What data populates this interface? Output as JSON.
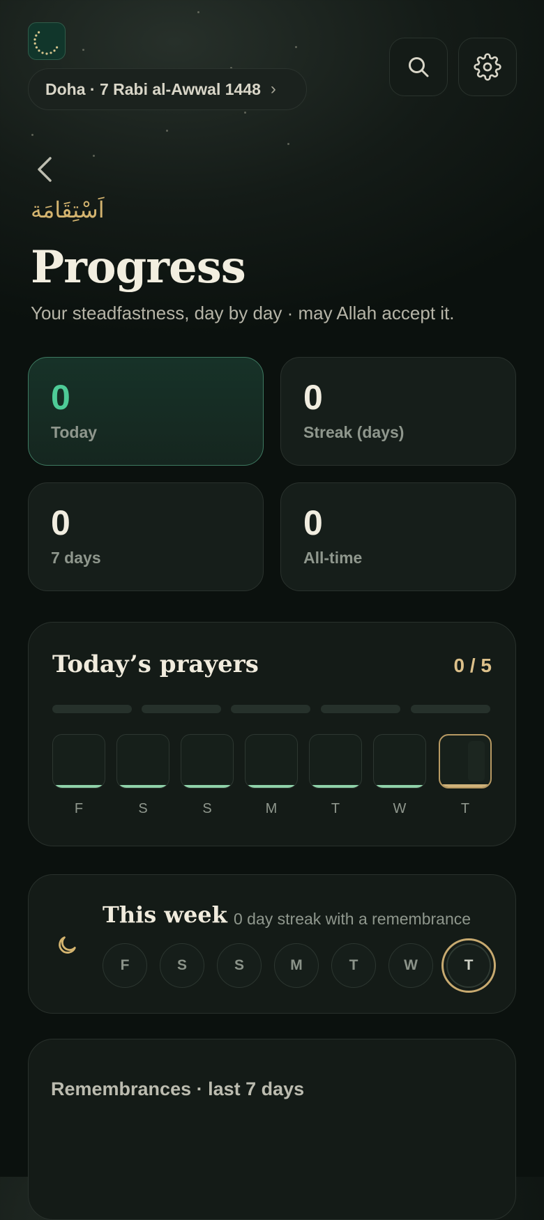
{
  "header": {
    "location_label": "Doha · 7 Rabi al-Awwal 1448",
    "chevron": "›",
    "logo_icon": "crescent-logo-icon",
    "search_icon": "search-icon",
    "settings_icon": "gear-icon"
  },
  "page": {
    "arabic_title": "اَسْتِقَامَة",
    "title": "Progress",
    "subtitle": "Your steadfastness, day by day · may Allah accept it."
  },
  "stats": [
    {
      "value": "0",
      "label": "Today"
    },
    {
      "value": "0",
      "label": "Streak (days)"
    },
    {
      "value": "0",
      "label": "7 days"
    },
    {
      "value": "0",
      "label": "All-time"
    }
  ],
  "prayers": {
    "title": "Today’s prayers",
    "count": "0 / 5",
    "completed": 0,
    "total": 5,
    "days": [
      "F",
      "S",
      "S",
      "M",
      "T",
      "W",
      "T"
    ]
  },
  "week": {
    "title": "This week",
    "subtitle": "0 day streak with a remembrance",
    "icon": "moon-icon",
    "days": [
      "F",
      "S",
      "S",
      "M",
      "T",
      "W",
      "T"
    ]
  },
  "remembrances": {
    "title": "Remembrances · last 7 days"
  },
  "colors": {
    "accent_green": "#4ecb97",
    "accent_gold": "#d4b46f",
    "background": "#0b110e"
  }
}
